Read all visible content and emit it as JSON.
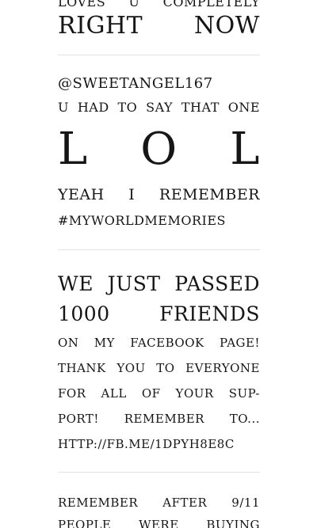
{
  "posts": [
    {
      "lines": [
        "LOVES U COMPLETELY",
        "RIGHT NOW"
      ]
    },
    {
      "lines": [
        "@SWEETANGEL167",
        "U HAD TO SAY THAT ONE",
        "L O L",
        "YEAH I REMEMBER",
        "#MYWORLDMEMORIES"
      ]
    },
    {
      "lines": [
        "WE JUST PASSED",
        "1000 FRIENDS",
        "ON MY FACEBOOK PAGE!",
        "THANK YOU TO EVERYONE",
        "FOR ALL OF YOUR SUP-",
        "PORT! REMEMBER TO...",
        "HTTP://FB.ME/1DPYH8E8C"
      ]
    },
    {
      "lines": [
        "REMEMBER AFTER 9/11",
        "PEOPLE WERE BUYING"
      ]
    }
  ],
  "colors": {
    "text": "#161616",
    "divider": "#e3e3e3",
    "background": "#ffffff"
  }
}
